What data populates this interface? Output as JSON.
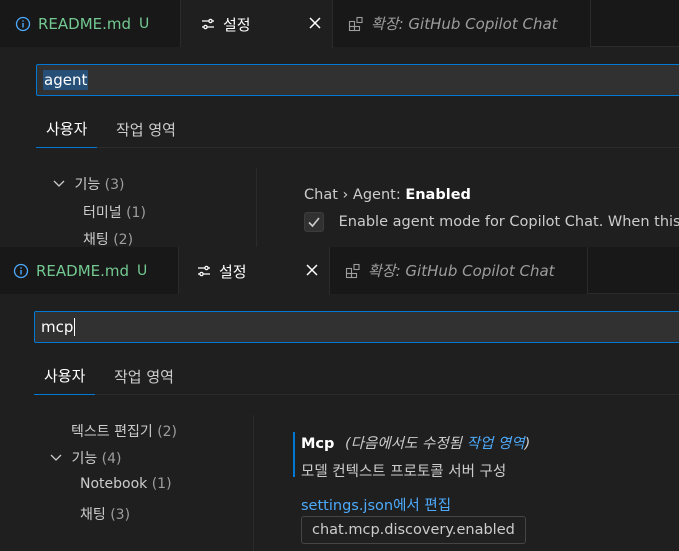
{
  "panel1": {
    "tabs": [
      {
        "icon": "info-icon",
        "label": "README.md",
        "badge": "U"
      },
      {
        "icon": "settings-sliders-icon",
        "label": "설정",
        "close": "✕"
      },
      {
        "icon": "extensions-icon",
        "label": "확장: GitHub Copilot Chat"
      }
    ],
    "search_value": "agent",
    "scopes": [
      "사용자",
      "작업 영역"
    ],
    "toc": [
      {
        "label": "기능",
        "count": "(3)",
        "expanded": true
      },
      {
        "label": "터미널",
        "count": "(1)"
      },
      {
        "label": "채팅",
        "count": "(2)"
      }
    ],
    "setting": {
      "category": "Chat › Agent: ",
      "name": "Enabled",
      "checked": true,
      "description": "Enable agent mode for Copilot Chat. When this"
    }
  },
  "panel2": {
    "tabs": [
      {
        "icon": "info-icon",
        "label": "README.md",
        "badge": "U"
      },
      {
        "icon": "settings-sliders-icon",
        "label": "설정",
        "close": "✕"
      },
      {
        "icon": "extensions-icon",
        "label": "확장: GitHub Copilot Chat"
      }
    ],
    "search_value": "mcp",
    "scopes": [
      "사용자",
      "작업 영역"
    ],
    "toc": [
      {
        "label": "텍스트 편집기",
        "count": "(2)"
      },
      {
        "label": "기능",
        "count": "(4)",
        "expanded": true
      },
      {
        "label": "Notebook",
        "count": "(1)"
      },
      {
        "label": "채팅",
        "count": "(3)"
      }
    ],
    "setting": {
      "name": "Mcp",
      "modified_prefix": "(다음에서도 수정됨 ",
      "modified_link": "작업 영역",
      "modified_suffix": ")",
      "description": "모델 컨텍스트 프로토콜 서버 구성",
      "edit_link": "settings.json에서 편집"
    },
    "tooltip": "chat.mcp.discovery.enabled"
  },
  "colors": {
    "accent": "#0078d4",
    "git_untracked": "#73c991",
    "link": "#4daafc"
  }
}
